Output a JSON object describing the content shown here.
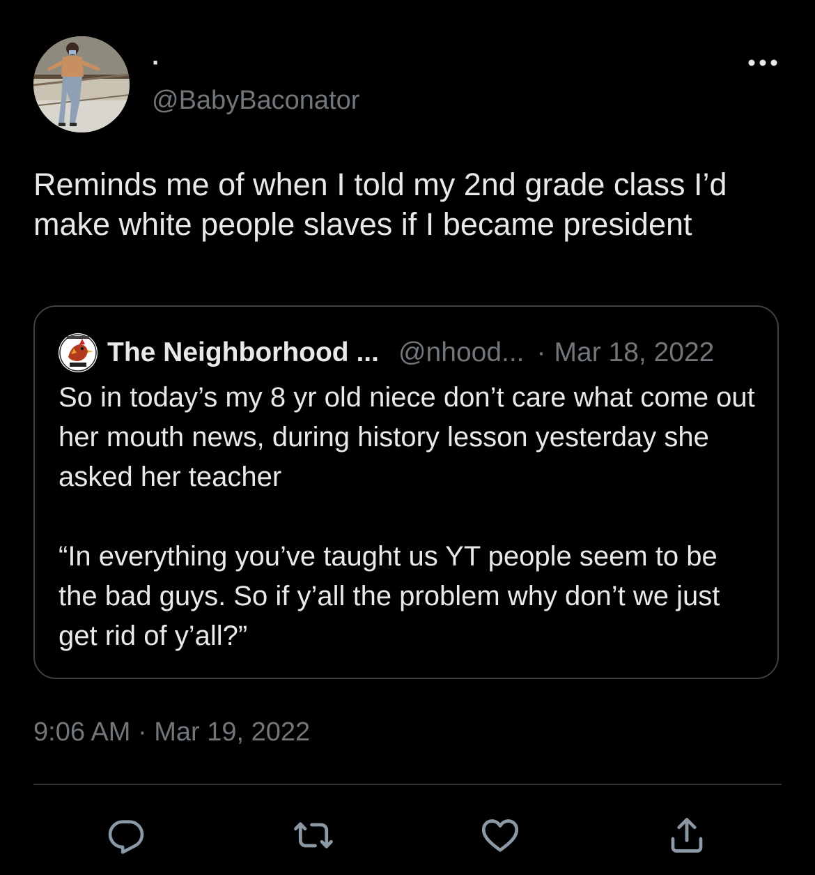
{
  "tweet": {
    "author": {
      "display_name": "·",
      "handle": "@BabyBaconator",
      "avatar_icon": "profile-photo"
    },
    "text": "Reminds me of when I told my 2nd grade class I’d make white people slaves if I became president",
    "timestamp": "9:06 AM · Mar 19, 2022",
    "more_icon": "more-horizontal-icon"
  },
  "quoted_tweet": {
    "display_name": "The Neighborhood ...",
    "handle": "@nhood...",
    "separator": "·",
    "date": "Mar 18, 2022",
    "avatar_icon": "neighborhood-logo",
    "paragraphs": [
      "So in today’s my 8 yr old niece don’t care what come out her mouth news, during history lesson yesterday she asked her teacher",
      "“In everything you’ve taught us YT people seem to be the bad guys. So if y’all the problem why don’t we just get rid of y’all?”"
    ]
  },
  "actions": [
    {
      "name": "reply",
      "icon": "reply-icon"
    },
    {
      "name": "retweet",
      "icon": "retweet-icon"
    },
    {
      "name": "like",
      "icon": "heart-icon"
    },
    {
      "name": "share",
      "icon": "share-icon"
    }
  ],
  "colors": {
    "background": "#000000",
    "primary_text": "#e7e9ea",
    "secondary_text": "#71767b",
    "border": "#3e4144",
    "divider": "#2f3336"
  }
}
